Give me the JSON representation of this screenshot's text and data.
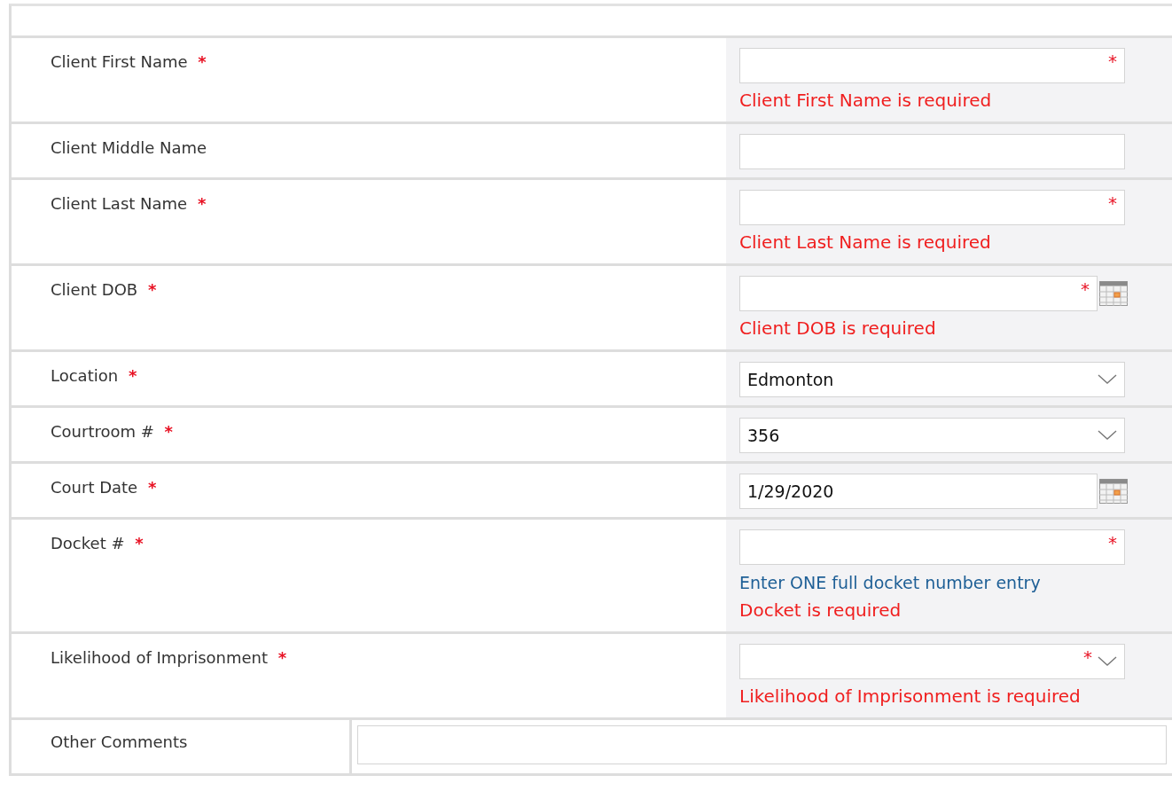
{
  "fields": [
    {
      "label": "Client First Name",
      "label_mark": "*",
      "kind": "text",
      "field_mark": "*",
      "error": "Client First Name is required"
    },
    {
      "label": "Client Middle Name",
      "kind": "text"
    },
    {
      "label": "Client Last Name",
      "label_mark": "*",
      "kind": "text",
      "field_mark": "*",
      "error": "Client Last Name is required"
    },
    {
      "label": "Client DOB",
      "label_mark": "*",
      "kind": "date",
      "field_mark": "*",
      "error": "Client DOB is required"
    },
    {
      "label": "Location",
      "label_mark": "*",
      "kind": "select",
      "value": "Edmonton"
    },
    {
      "label": "Courtroom #",
      "label_mark": "*",
      "kind": "select",
      "value": "356"
    },
    {
      "label": "Court Date",
      "label_mark": "*",
      "kind": "date",
      "value": "1/29/2020"
    },
    {
      "label": "Docket #",
      "label_mark": "*",
      "kind": "text",
      "field_mark": "*",
      "hint": "Enter ONE full docket number entry",
      "error": "Docket is required"
    },
    {
      "label": "Likelihood of Imprisonment",
      "label_mark": "*",
      "kind": "select",
      "field_mark": "*",
      "error": "Likelihood of Imprisonment is required"
    }
  ],
  "comments": {
    "label": "Other Comments"
  }
}
